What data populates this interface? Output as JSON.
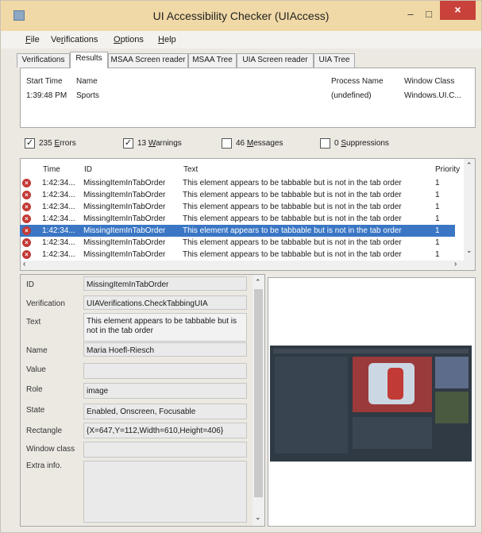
{
  "window": {
    "title": "UI Accessibility Checker (UIAccess)",
    "minimize": "–",
    "maximize": "□",
    "close": "×"
  },
  "menu": [
    {
      "pre": "",
      "u": "F",
      "post": "ile"
    },
    {
      "pre": "Ve",
      "u": "r",
      "post": "ifications"
    },
    {
      "pre": "",
      "u": "O",
      "post": "ptions"
    },
    {
      "pre": "",
      "u": "H",
      "post": "elp"
    }
  ],
  "tabs": [
    "Verifications",
    "Results",
    "MSAA Screen reader",
    "MSAA Tree",
    "UIA Screen reader",
    "UIA Tree"
  ],
  "process_table": {
    "headers": [
      "Start Time",
      "Name",
      "Process Name",
      "Window Class"
    ],
    "row": [
      "1:39:48 PM",
      "Sports",
      "(undefined)",
      "Windows.UI.C..."
    ]
  },
  "filters": [
    {
      "checked": true,
      "count": "235",
      "label": "Errors",
      "u": "E"
    },
    {
      "checked": true,
      "count": "13",
      "label": "Warnings",
      "u": "W"
    },
    {
      "checked": false,
      "count": "46",
      "label": "Messages",
      "u": "M"
    },
    {
      "checked": false,
      "count": "0",
      "label": "Suppressions",
      "u": "S"
    }
  ],
  "results": {
    "headers": [
      "Time",
      "ID",
      "Text",
      "Priority"
    ],
    "rows": [
      {
        "time": "1:42:34...",
        "id": "MissingItemInTabOrder",
        "text": "This element appears to be tabbable but is not in the tab order",
        "priority": "1",
        "selected": false
      },
      {
        "time": "1:42:34...",
        "id": "MissingItemInTabOrder",
        "text": "This element appears to be tabbable but is not in the tab order",
        "priority": "1",
        "selected": false
      },
      {
        "time": "1:42:34...",
        "id": "MissingItemInTabOrder",
        "text": "This element appears to be tabbable but is not in the tab order",
        "priority": "1",
        "selected": false
      },
      {
        "time": "1:42:34...",
        "id": "MissingItemInTabOrder",
        "text": "This element appears to be tabbable but is not in the tab order",
        "priority": "1",
        "selected": false
      },
      {
        "time": "1:42:34...",
        "id": "MissingItemInTabOrder",
        "text": "This element appears to be tabbable but is not in the tab order",
        "priority": "1",
        "selected": true
      },
      {
        "time": "1:42:34...",
        "id": "MissingItemInTabOrder",
        "text": "This element appears to be tabbable but is not in the tab order",
        "priority": "1",
        "selected": false
      },
      {
        "time": "1:42:34...",
        "id": "MissingItemInTabOrder",
        "text": "This element appears to be tabbable but is not in the tab order",
        "priority": "1",
        "selected": false
      }
    ]
  },
  "details": [
    {
      "label": "ID",
      "value": "MissingItemInTabOrder"
    },
    {
      "label": "Verification",
      "value": "UIAVerifications.CheckTabbingUIA"
    },
    {
      "label": "Text",
      "value": "This element appears to be tabbable but is not in the tab order"
    },
    {
      "label": "Name",
      "value": "Maria Hoefl-Riesch"
    },
    {
      "label": "Value",
      "value": ""
    },
    {
      "label": "Role",
      "value": "image"
    },
    {
      "label": "State",
      "value": "Enabled, Onscreen, Focusable"
    },
    {
      "label": "Rectangle",
      "value": "{X=647,Y=112,Width=610,Height=406}"
    },
    {
      "label": "Window class",
      "value": ""
    },
    {
      "label": "Extra info.",
      "value": ""
    }
  ],
  "colors": {
    "titlebar": "#f0d9a6",
    "close": "#c8413a",
    "selection": "#3a76c4",
    "error": "#c23a36"
  }
}
